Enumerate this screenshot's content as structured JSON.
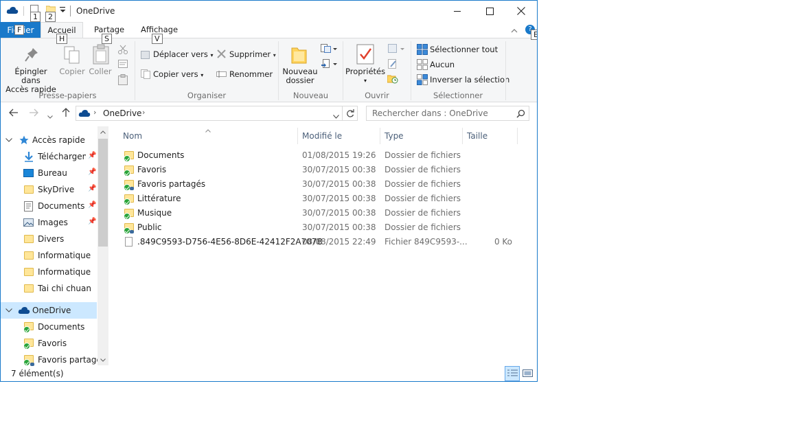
{
  "window": {
    "title": "OneDrive",
    "quick_access_keytips": [
      "1",
      "2"
    ],
    "controls": {
      "minimize": "—",
      "maximize": "☐",
      "close": "✕"
    }
  },
  "ribbon": {
    "tabs": {
      "file": "Fichier",
      "home": "Accueil",
      "share": "Partage",
      "view": "Affichage"
    },
    "keytips": {
      "file": "F",
      "home": "H",
      "share": "S",
      "view": "V",
      "help": "E"
    },
    "groups": {
      "clipboard": {
        "label": "Presse-papiers",
        "pin_line1": "Épingler dans",
        "pin_line2": "Accès rapide",
        "copy": "Copier",
        "paste": "Coller"
      },
      "organize": {
        "label": "Organiser",
        "move_to": "Déplacer vers",
        "copy_to": "Copier vers",
        "delete": "Supprimer",
        "rename": "Renommer"
      },
      "new": {
        "label": "Nouveau",
        "new_folder_line1": "Nouveau",
        "new_folder_line2": "dossier"
      },
      "open": {
        "label": "Ouvrir",
        "properties": "Propriétés"
      },
      "select": {
        "label": "Sélectionner",
        "select_all": "Sélectionner tout",
        "select_none": "Aucun",
        "invert": "Inverser la sélection"
      }
    }
  },
  "address": {
    "path": [
      "OneDrive"
    ],
    "search_placeholder": "Rechercher dans : OneDrive"
  },
  "nav": {
    "quick_access": "Accès rapide",
    "items": [
      {
        "label": "Téléchargements",
        "pinned": true
      },
      {
        "label": "Bureau",
        "pinned": true
      },
      {
        "label": "SkyDrive",
        "pinned": true
      },
      {
        "label": "Documents",
        "pinned": true
      },
      {
        "label": "Images",
        "pinned": true
      },
      {
        "label": "Divers",
        "pinned": false
      },
      {
        "label": "Informatique",
        "pinned": false
      },
      {
        "label": "Informatique",
        "pinned": false
      },
      {
        "label": "Tai chi chuan",
        "pinned": false
      }
    ],
    "onedrive": "OneDrive",
    "onedrive_children": [
      "Documents",
      "Favoris",
      "Favoris partagés"
    ]
  },
  "list": {
    "columns": {
      "name": "Nom",
      "modified": "Modifié le",
      "type": "Type",
      "size": "Taille"
    },
    "rows": [
      {
        "name": "Documents",
        "modified": "01/08/2015 19:26",
        "type": "Dossier de fichiers",
        "size": "",
        "kind": "folder",
        "shared": false
      },
      {
        "name": "Favoris",
        "modified": "30/07/2015 00:38",
        "type": "Dossier de fichiers",
        "size": "",
        "kind": "folder",
        "shared": false
      },
      {
        "name": "Favoris partagés",
        "modified": "30/07/2015 00:38",
        "type": "Dossier de fichiers",
        "size": "",
        "kind": "folder",
        "shared": true
      },
      {
        "name": "Littérature",
        "modified": "30/07/2015 00:38",
        "type": "Dossier de fichiers",
        "size": "",
        "kind": "folder",
        "shared": false
      },
      {
        "name": "Musique",
        "modified": "30/07/2015 00:38",
        "type": "Dossier de fichiers",
        "size": "",
        "kind": "folder",
        "shared": false
      },
      {
        "name": "Public",
        "modified": "30/07/2015 00:38",
        "type": "Dossier de fichiers",
        "size": "",
        "kind": "folder",
        "shared": true
      },
      {
        "name": ".849C9593-D756-4E56-8D6E-42412F2A707B",
        "modified": "08/08/2015 22:49",
        "type": "Fichier 849C9593-...",
        "size": "0 Ko",
        "kind": "file",
        "shared": false
      }
    ]
  },
  "status": {
    "count": "7 élément(s)"
  },
  "colors": {
    "accent": "#1979ca",
    "selection": "#cce8ff",
    "sync_check": "#2aa53a",
    "folder": "#ffe699"
  }
}
